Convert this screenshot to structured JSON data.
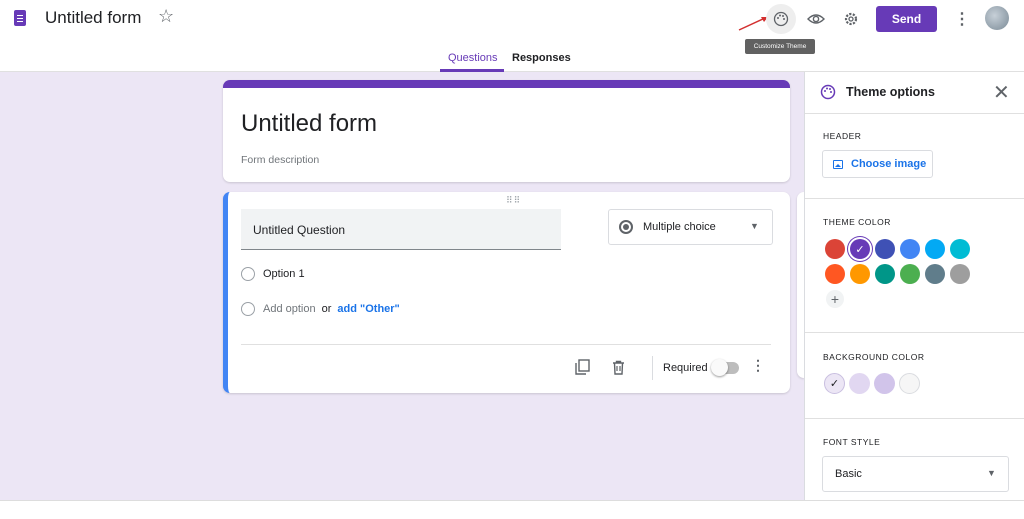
{
  "header": {
    "form_title": "Untitled form",
    "send_label": "Send",
    "tooltip": "Customize Theme",
    "icons": [
      "forms-doc-icon",
      "star-icon",
      "palette-icon",
      "eye-icon",
      "gear-icon",
      "more-vert-icon",
      "avatar"
    ]
  },
  "tabs": [
    {
      "label": "Questions",
      "active": true
    },
    {
      "label": "Responses",
      "active": false
    }
  ],
  "form": {
    "title": "Untitled form",
    "description": "Form description",
    "accent_color": "#673ab7"
  },
  "question": {
    "title": "Untitled Question",
    "type": "Multiple choice",
    "option1": "Option 1",
    "add_option": "Add option",
    "or": "or",
    "add_other": "add \"Other\"",
    "required_label": "Required",
    "required": false
  },
  "theme_panel": {
    "title": "Theme options",
    "header_label": "HEADER",
    "choose_image": "Choose image",
    "theme_color_label": "THEME COLOR",
    "theme_colors": [
      "#db4437",
      "#673ab7",
      "#3f51b5",
      "#4285f4",
      "#03a9f4",
      "#00bcd4",
      "#ff5722",
      "#ff9800",
      "#009688",
      "#4caf50",
      "#607d8b",
      "#9e9e9e"
    ],
    "selected_theme_color": "#673ab7",
    "background_color_label": "BACKGROUND COLOR",
    "background_colors": [
      "#ece6f5",
      "#e1d7f1",
      "#d1c4ea",
      "#f6f6f6"
    ],
    "font_style_label": "FONT STYLE",
    "font_style": "Basic"
  }
}
